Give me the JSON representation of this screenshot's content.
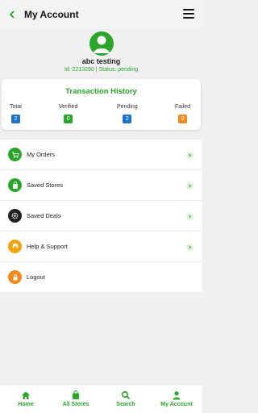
{
  "header": {
    "title": "My Account",
    "back_icon": "chevron-left-icon",
    "menu_icon": "hamburger-icon"
  },
  "profile": {
    "name": "abc testing",
    "meta": "Id: 2213290 | Status: pending",
    "avatar_icon": "user-icon"
  },
  "transactions": {
    "title": "Transaction History",
    "stats": [
      {
        "label": "Total",
        "value": "2",
        "color": "#1a73c9"
      },
      {
        "label": "Verified",
        "value": "0",
        "color": "#2aa52a"
      },
      {
        "label": "Pending",
        "value": "2",
        "color": "#1a73c9"
      },
      {
        "label": "Failed",
        "value": "0",
        "color": "#f0891f"
      }
    ]
  },
  "menu": [
    {
      "label": "My Orders",
      "icon": "cart-icon",
      "color": "#2aa52a",
      "chevron": true
    },
    {
      "label": "Saved Stores",
      "icon": "bag-icon",
      "color": "#2aa52a",
      "chevron": true
    },
    {
      "label": "Saved Deals",
      "icon": "gear-icon",
      "color": "#222222",
      "chevron": true
    },
    {
      "label": "Help & Support",
      "icon": "question-icon",
      "color": "#f0a30a",
      "chevron": true
    },
    {
      "label": "Logout",
      "icon": "lock-icon",
      "color": "#f0891f",
      "chevron": false
    }
  ],
  "bottom_nav": [
    {
      "label": "Home",
      "icon": "home-icon"
    },
    {
      "label": "All Stores",
      "icon": "bag-icon"
    },
    {
      "label": "Search",
      "icon": "search-icon"
    },
    {
      "label": "My Account",
      "icon": "user-icon"
    }
  ],
  "accent_color": "#2aa52a"
}
